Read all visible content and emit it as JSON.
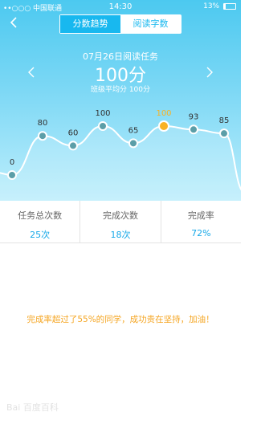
{
  "status_bar": {
    "carrier": "••○○○ 中国联通",
    "time": "14:30",
    "battery": "13%"
  },
  "tabs": [
    {
      "label": "分数趋势",
      "active": true
    },
    {
      "label": "阅读字数",
      "active": false
    }
  ],
  "header": {
    "date_title": "07月26日阅读任务",
    "score": "100分",
    "class_average": "班级平均分  100分"
  },
  "chart_data": {
    "type": "line",
    "values": [
      0,
      80,
      60,
      100,
      65,
      100,
      93,
      85
    ],
    "value_labels": [
      "0",
      "80",
      "60",
      "100",
      "65",
      "100",
      "93",
      "85"
    ],
    "highlight_index": 5
  },
  "stats": [
    {
      "label": "任务总次数",
      "value": "25次"
    },
    {
      "label": "完成次数",
      "value": "18次"
    },
    {
      "label": "完成率",
      "value": "72%"
    }
  ],
  "message": "完成率超过了55%的同学，成功贵在坚持，加油！",
  "watermark": "Bai 百度百科",
  "colors": {
    "accent": "#18b8ef",
    "highlight": "#f9b224",
    "point": "#5b9ea8",
    "message": "#f5a623"
  }
}
